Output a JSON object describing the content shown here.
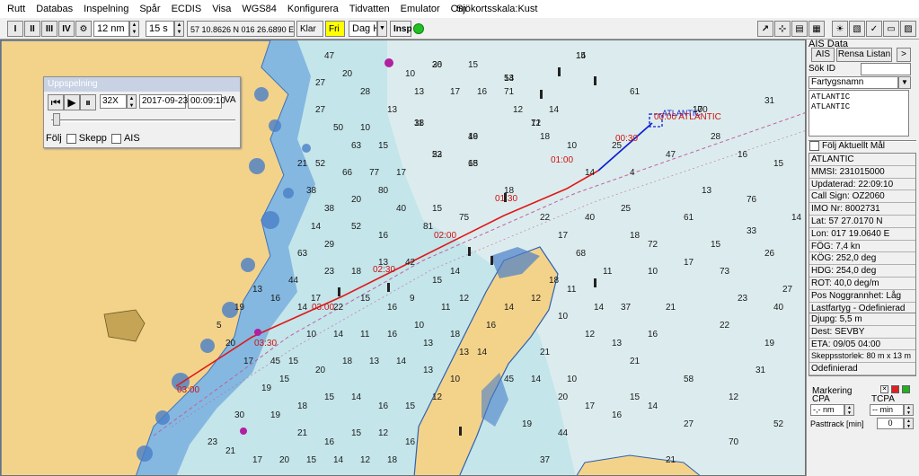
{
  "menu": {
    "items": [
      "Rutt",
      "Databas",
      "Inspelning",
      "Spår",
      "ECDIS",
      "Visa",
      "WGS84",
      "Konfigurera",
      "Tidvatten",
      "Emulator",
      "Om"
    ],
    "chart_scale": "Sjökortsskala:Kust"
  },
  "toolbar": {
    "range": "12 nm",
    "interval": "15 s",
    "position": "57 10.8626 N  016 26.6890 E",
    "state": "Klar",
    "free_label": "Fri",
    "mode": "Dag H",
    "insp": "Insp",
    "status_color": "#22c022",
    "buttons_left": [
      "I",
      "II",
      "III",
      "IV"
    ]
  },
  "playback": {
    "title": "Uppspelning",
    "speed": "32X",
    "date": "2017-09-23",
    "time": "00:09:10",
    "va": "VA",
    "follow": "Följ",
    "ship": "Skepp",
    "ais": "AIS"
  },
  "chart": {
    "vessel_name": "ATLANTIC",
    "vessel_label": "00:00 ATLANTIC",
    "track_color": "#e01818",
    "time_labels": [
      "00:30",
      "01:00",
      "01:30",
      "02:00",
      "02:30",
      "03:00",
      "03:30",
      "03:00"
    ],
    "soundings": [
      "36",
      "54",
      "71",
      "14",
      "100",
      "38",
      "53",
      "65",
      "49",
      "18",
      "10",
      "14",
      "4",
      "13",
      "72",
      "61",
      "76",
      "26",
      "33",
      "18",
      "25",
      "10",
      "73",
      "21",
      "16",
      "22",
      "40",
      "58",
      "31",
      "27",
      "70",
      "52",
      "21",
      "44",
      "19",
      "37",
      "45",
      "10",
      "12",
      "14",
      "37",
      "68",
      "71",
      "61",
      "47",
      "40",
      "17",
      "22",
      "15",
      "75",
      "81",
      "40",
      "16",
      "52",
      "29",
      "63",
      "44",
      "17",
      "22",
      "15",
      "16",
      "9",
      "10",
      "16",
      "11",
      "14",
      "10",
      "15",
      "20",
      "18",
      "13",
      "14",
      "13",
      "10",
      "12",
      "15",
      "16",
      "14",
      "15",
      "18",
      "19",
      "21",
      "16",
      "15",
      "12",
      "16",
      "18",
      "12",
      "14",
      "15",
      "20",
      "17",
      "21",
      "23",
      "30",
      "19",
      "15",
      "45",
      "17",
      "20",
      "5",
      "19",
      "13",
      "16",
      "14",
      "23",
      "18",
      "13",
      "42",
      "15",
      "14",
      "12",
      "11",
      "13",
      "18",
      "13",
      "14",
      "16",
      "14",
      "12",
      "18",
      "11",
      "10",
      "21",
      "14",
      "20",
      "17",
      "16",
      "15",
      "14",
      "21",
      "13",
      "11",
      "18",
      "25",
      "14",
      "12",
      "16",
      "17",
      "15",
      "13",
      "28",
      "20",
      "47",
      "27",
      "50",
      "63",
      "77",
      "66",
      "52",
      "38",
      "38",
      "20",
      "80",
      "17",
      "15",
      "10",
      "13",
      "10",
      "27",
      "21",
      "14",
      "17",
      "15",
      "23",
      "12",
      "19",
      "27",
      "14",
      "15",
      "16",
      "28",
      "31",
      "20",
      "13",
      "12",
      "15",
      "17",
      "11",
      "22",
      "18",
      "16"
    ]
  },
  "ais_panel": {
    "title": "AIS Data",
    "ais_button": "AIS",
    "clear_button": "Rensa Listan",
    "next_button": ">",
    "search_label": "Sök ID",
    "search_value": "",
    "select_value": "Fartygsnamn",
    "list": [
      "ATLANTIC",
      "ATLANTIC"
    ],
    "follow_current": "Följ Aktuellt Mål",
    "info": [
      "ATLANTIC",
      "MMSI: 231015000",
      "Updaterad: 22:09:10",
      "Call Sign: OZ2060",
      "IMO Nr: 8002731",
      "Lat: 57 27.0170 N",
      "Lon: 017 19.0640 E",
      "FÖG: 7,4 kn",
      "KÖG: 252,0 deg",
      "HDG: 254,0 deg",
      "ROT: 40,0 deg/m",
      "Pos Noggrannhet:  Låg",
      "Lastfartyg - Odefinierad"
    ],
    "info2": [
      "Djupg: 5,5 m",
      "Dest: SEVBY",
      "ETA: 09/05 04:00",
      "Skeppsstorlek: 80 m x 13 m",
      "Odefinierad"
    ],
    "marking": "Markering",
    "cpa": "CPA",
    "tcpa": "TCPA",
    "cpa_value": "-,- nm",
    "tcpa_value": "-- min",
    "pasttrack": "Pasttrack [min]",
    "pasttrack_value": "0"
  }
}
